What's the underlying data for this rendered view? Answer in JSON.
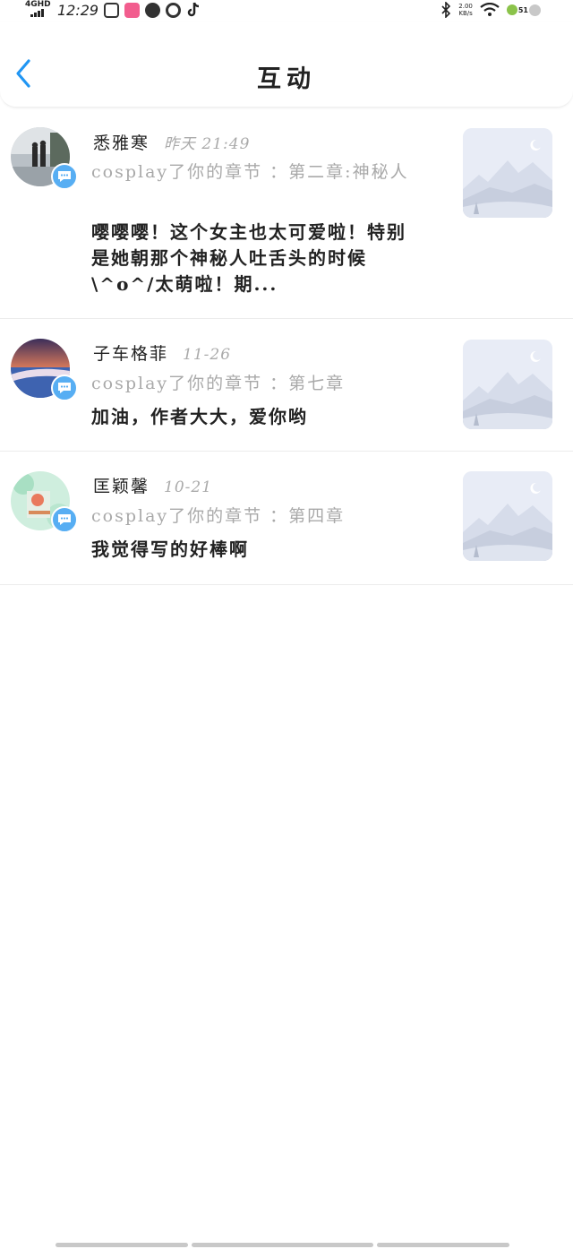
{
  "status_bar": {
    "network": "4GHD",
    "time": "12:29",
    "speed_value": "2.00",
    "speed_unit": "KB/s",
    "battery": "51"
  },
  "header": {
    "title": "互动"
  },
  "items": [
    {
      "name": "悉雅寒",
      "time": "昨天 21:49",
      "chapter": "cosplay了你的章节 ：第二章:神秘人",
      "content": "嘤嘤嘤！这个女主也太可爱啦！特别是她朝那个神秘人吐舌头的时候\\^o^/太萌啦！期..."
    },
    {
      "name": "子车格菲",
      "time": "11-26",
      "chapter": "cosplay了你的章节 ：第七章",
      "content": "加油，作者大大，爱你哟"
    },
    {
      "name": "匡颖馨",
      "time": "10-21",
      "chapter": "cosplay了你的章节 ：第四章",
      "content": "我觉得写的好棒啊"
    }
  ],
  "colors": {
    "accent": "#2196f3",
    "badge": "#57aef3",
    "secondary_text": "#a9a9a9"
  }
}
